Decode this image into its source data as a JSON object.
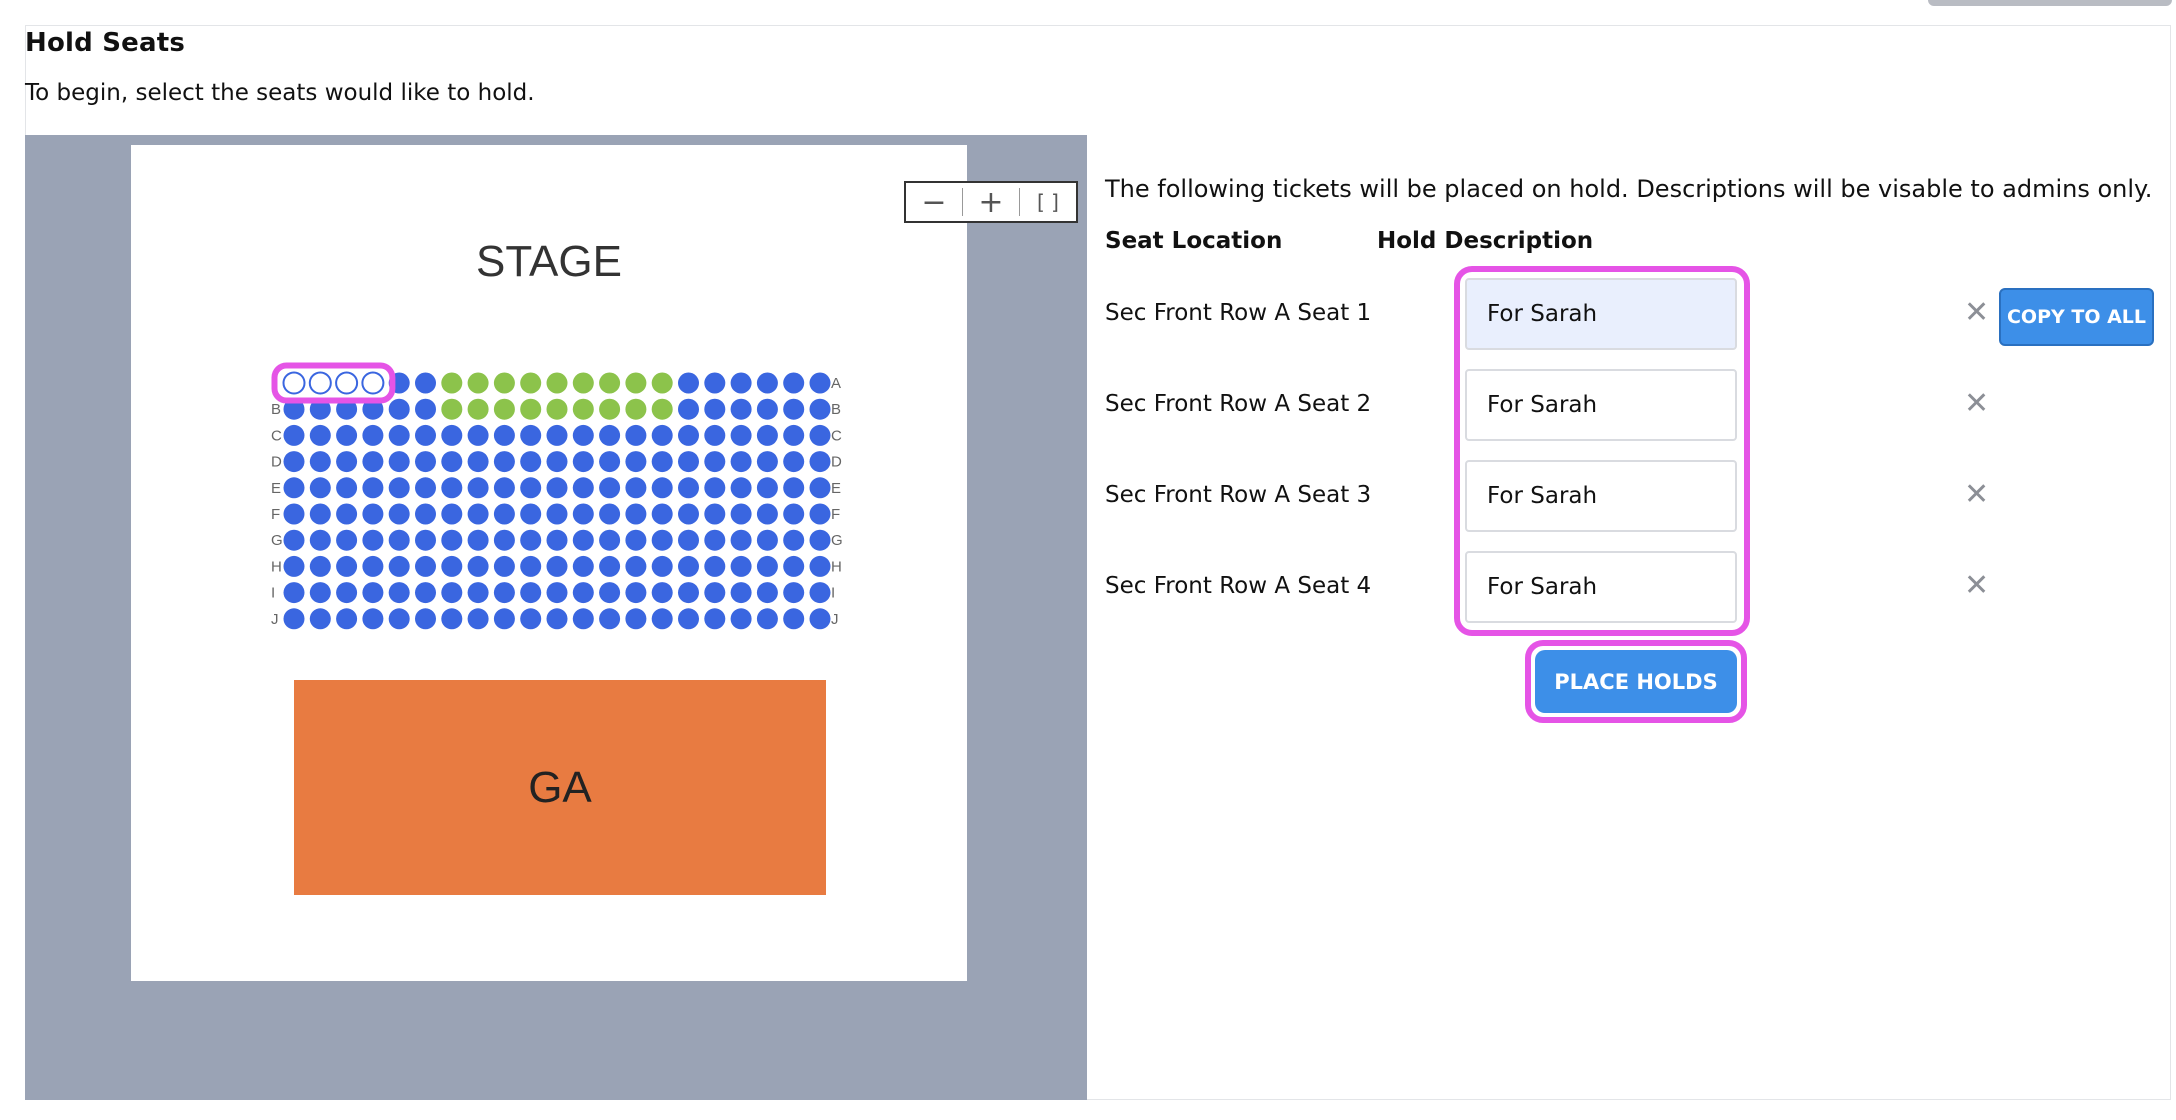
{
  "header": {
    "title": "Hold Seats",
    "subtitle": "To begin, select the seats would like to hold."
  },
  "map": {
    "stage_label": "STAGE",
    "ga_label": "GA",
    "zoom_out": "−",
    "zoom_in": "+",
    "fit": "[ ]",
    "rows": [
      "A",
      "B",
      "C",
      "D",
      "E",
      "F",
      "G",
      "H",
      "I",
      "J"
    ],
    "seats_per_row": 21,
    "colors": {
      "available": "#3a66e0",
      "held": "#8cc34b",
      "selected_fill": "#ffffff",
      "selected_stroke": "#3a66e0",
      "highlight": "#e554e6"
    },
    "held_seats": {
      "A": [
        7,
        8,
        9,
        10,
        11,
        12,
        13,
        14,
        15
      ],
      "B": [
        7,
        8,
        9,
        10,
        11,
        12,
        13,
        14,
        15
      ]
    },
    "selected_seats": {
      "A": [
        1,
        2,
        3,
        4
      ]
    }
  },
  "panel": {
    "intro": "The following tickets will be placed on hold. Descriptions will be visable to admins only.",
    "col_seat": "Seat Location",
    "col_desc": "Hold Description",
    "holds": [
      {
        "seat": "Sec Front Row A Seat 1",
        "desc": "For Sarah"
      },
      {
        "seat": "Sec Front Row A Seat 2",
        "desc": "For Sarah"
      },
      {
        "seat": "Sec Front Row A Seat 3",
        "desc": "For Sarah"
      },
      {
        "seat": "Sec Front Row A Seat 4",
        "desc": "For Sarah"
      }
    ],
    "remove_glyph": "✕",
    "copy_to_all": "COPY TO ALL",
    "place_holds": "PLACE HOLDS"
  }
}
